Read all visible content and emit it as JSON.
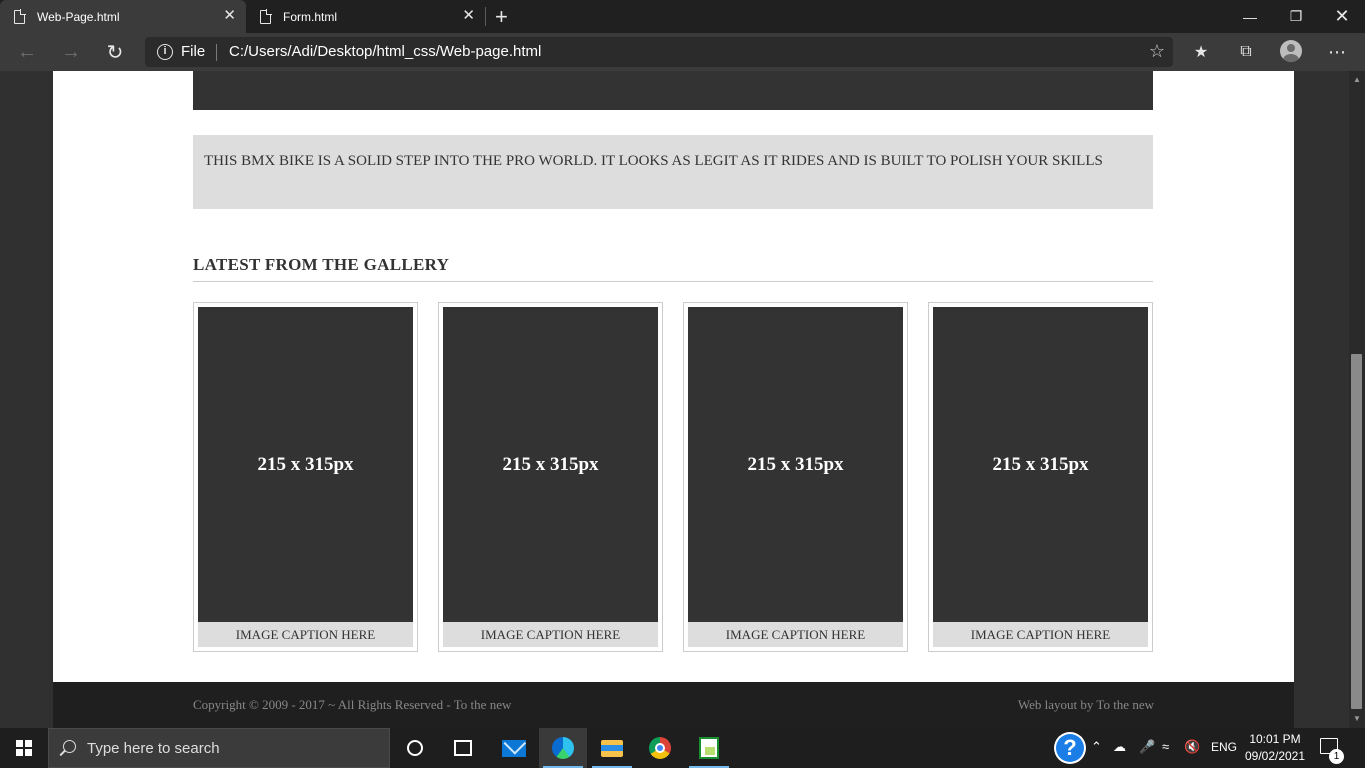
{
  "browser": {
    "tabs": [
      {
        "title": "Web-Page.html",
        "active": true
      },
      {
        "title": "Form.html",
        "active": false
      }
    ],
    "address_scheme_label": "File",
    "url": "C:/Users/Adi/Desktop/html_css/Web-page.html",
    "icons": {
      "back": "back-arrow-icon",
      "forward": "forward-arrow-icon",
      "refresh": "refresh-icon",
      "site_info": "info-icon",
      "add_favorite": "add-favorite-star-icon",
      "favorites": "favorites-icon",
      "collections": "collections-icon",
      "profile": "profile-avatar-icon",
      "menu": "more-menu-icon"
    }
  },
  "page": {
    "intro_text": "THIS BMX BIKE IS A SOLID STEP INTO THE PRO WORLD. IT LOOKS AS LEGIT AS IT RIDES AND IS BUILT TO POLISH YOUR SKILLS",
    "gallery_title": "LATEST FROM THE GALLERY",
    "gallery": [
      {
        "placeholder": "215 x 315px",
        "caption": "IMAGE CAPTION HERE"
      },
      {
        "placeholder": "215 x 315px",
        "caption": "IMAGE CAPTION HERE"
      },
      {
        "placeholder": "215 x 315px",
        "caption": "IMAGE CAPTION HERE"
      },
      {
        "placeholder": "215 x 315px",
        "caption": "IMAGE CAPTION HERE"
      }
    ],
    "footer_left": "Copyright © 2009 - 2017 ~ All Rights Reserved - To the new",
    "footer_right": "Web layout by To the new"
  },
  "colors": {
    "page_dark": "#333333",
    "panel_gray": "#dddddd",
    "footer_bg": "#1f1f1f",
    "text": "#333333"
  },
  "taskbar": {
    "search_placeholder": "Type here to search",
    "language": "ENG",
    "time": "10:01 PM",
    "date": "09/02/2021",
    "notification_count": "1",
    "help_glyph": "?"
  }
}
